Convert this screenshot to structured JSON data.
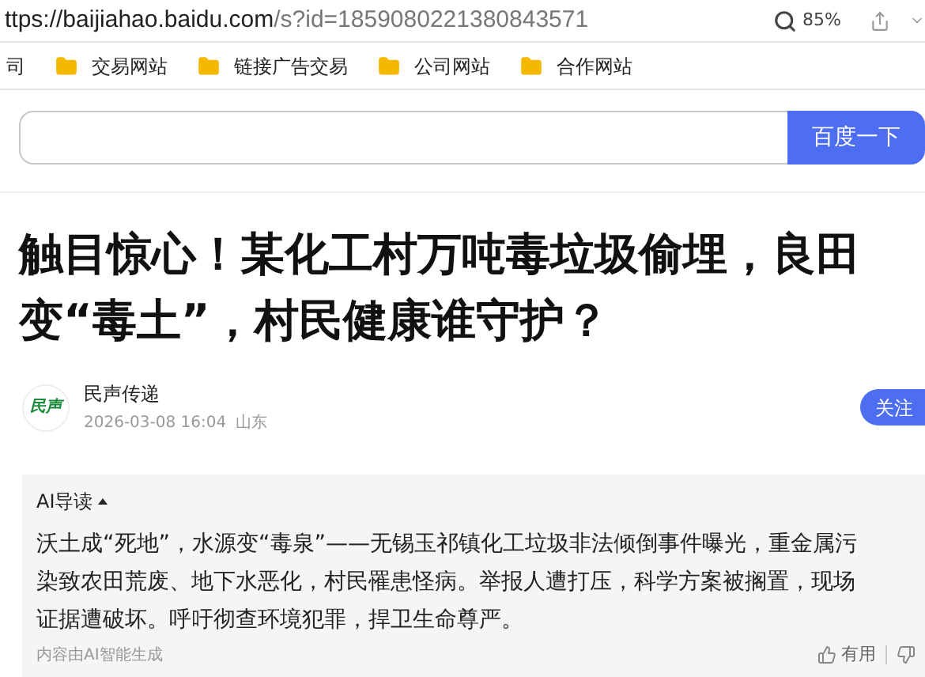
{
  "address_bar": {
    "url_host": "ttps://baijiahao.baidu.com",
    "url_path": "/s?id=1859080221380843571",
    "zoom": "85%"
  },
  "bookmarks": [
    {
      "label": "司",
      "folder": false
    },
    {
      "label": "交易网站",
      "folder": true
    },
    {
      "label": "链接广告交易",
      "folder": true
    },
    {
      "label": "公司网站",
      "folder": true
    },
    {
      "label": "合作网站",
      "folder": true
    }
  ],
  "search": {
    "button": "百度一下"
  },
  "article": {
    "title": "触目惊心！某化工村万吨毒垃圾偷埋，良田变“毒土”，村民健康谁守护？",
    "author": {
      "name": "民声传递",
      "avatar_text": "民声",
      "date": "2026-03-08 16:04",
      "location": "山东",
      "follow": "关注"
    },
    "ai_summary": {
      "heading": "AI导读",
      "expanded": true,
      "text": "沃土成“死地”，水源变“毒泉”——无锡玉祁镇化工垃圾非法倾倒事件曝光，重金属污染致农田荒废、地下水恶化，村民罹患怪病。举报人遭打压，科学方案被搁置，现场证据遭破坏。呼吁彻查环境犯罪，捍卫生命尊严。",
      "note": "内容由AI智能生成",
      "useful": "有用"
    }
  }
}
